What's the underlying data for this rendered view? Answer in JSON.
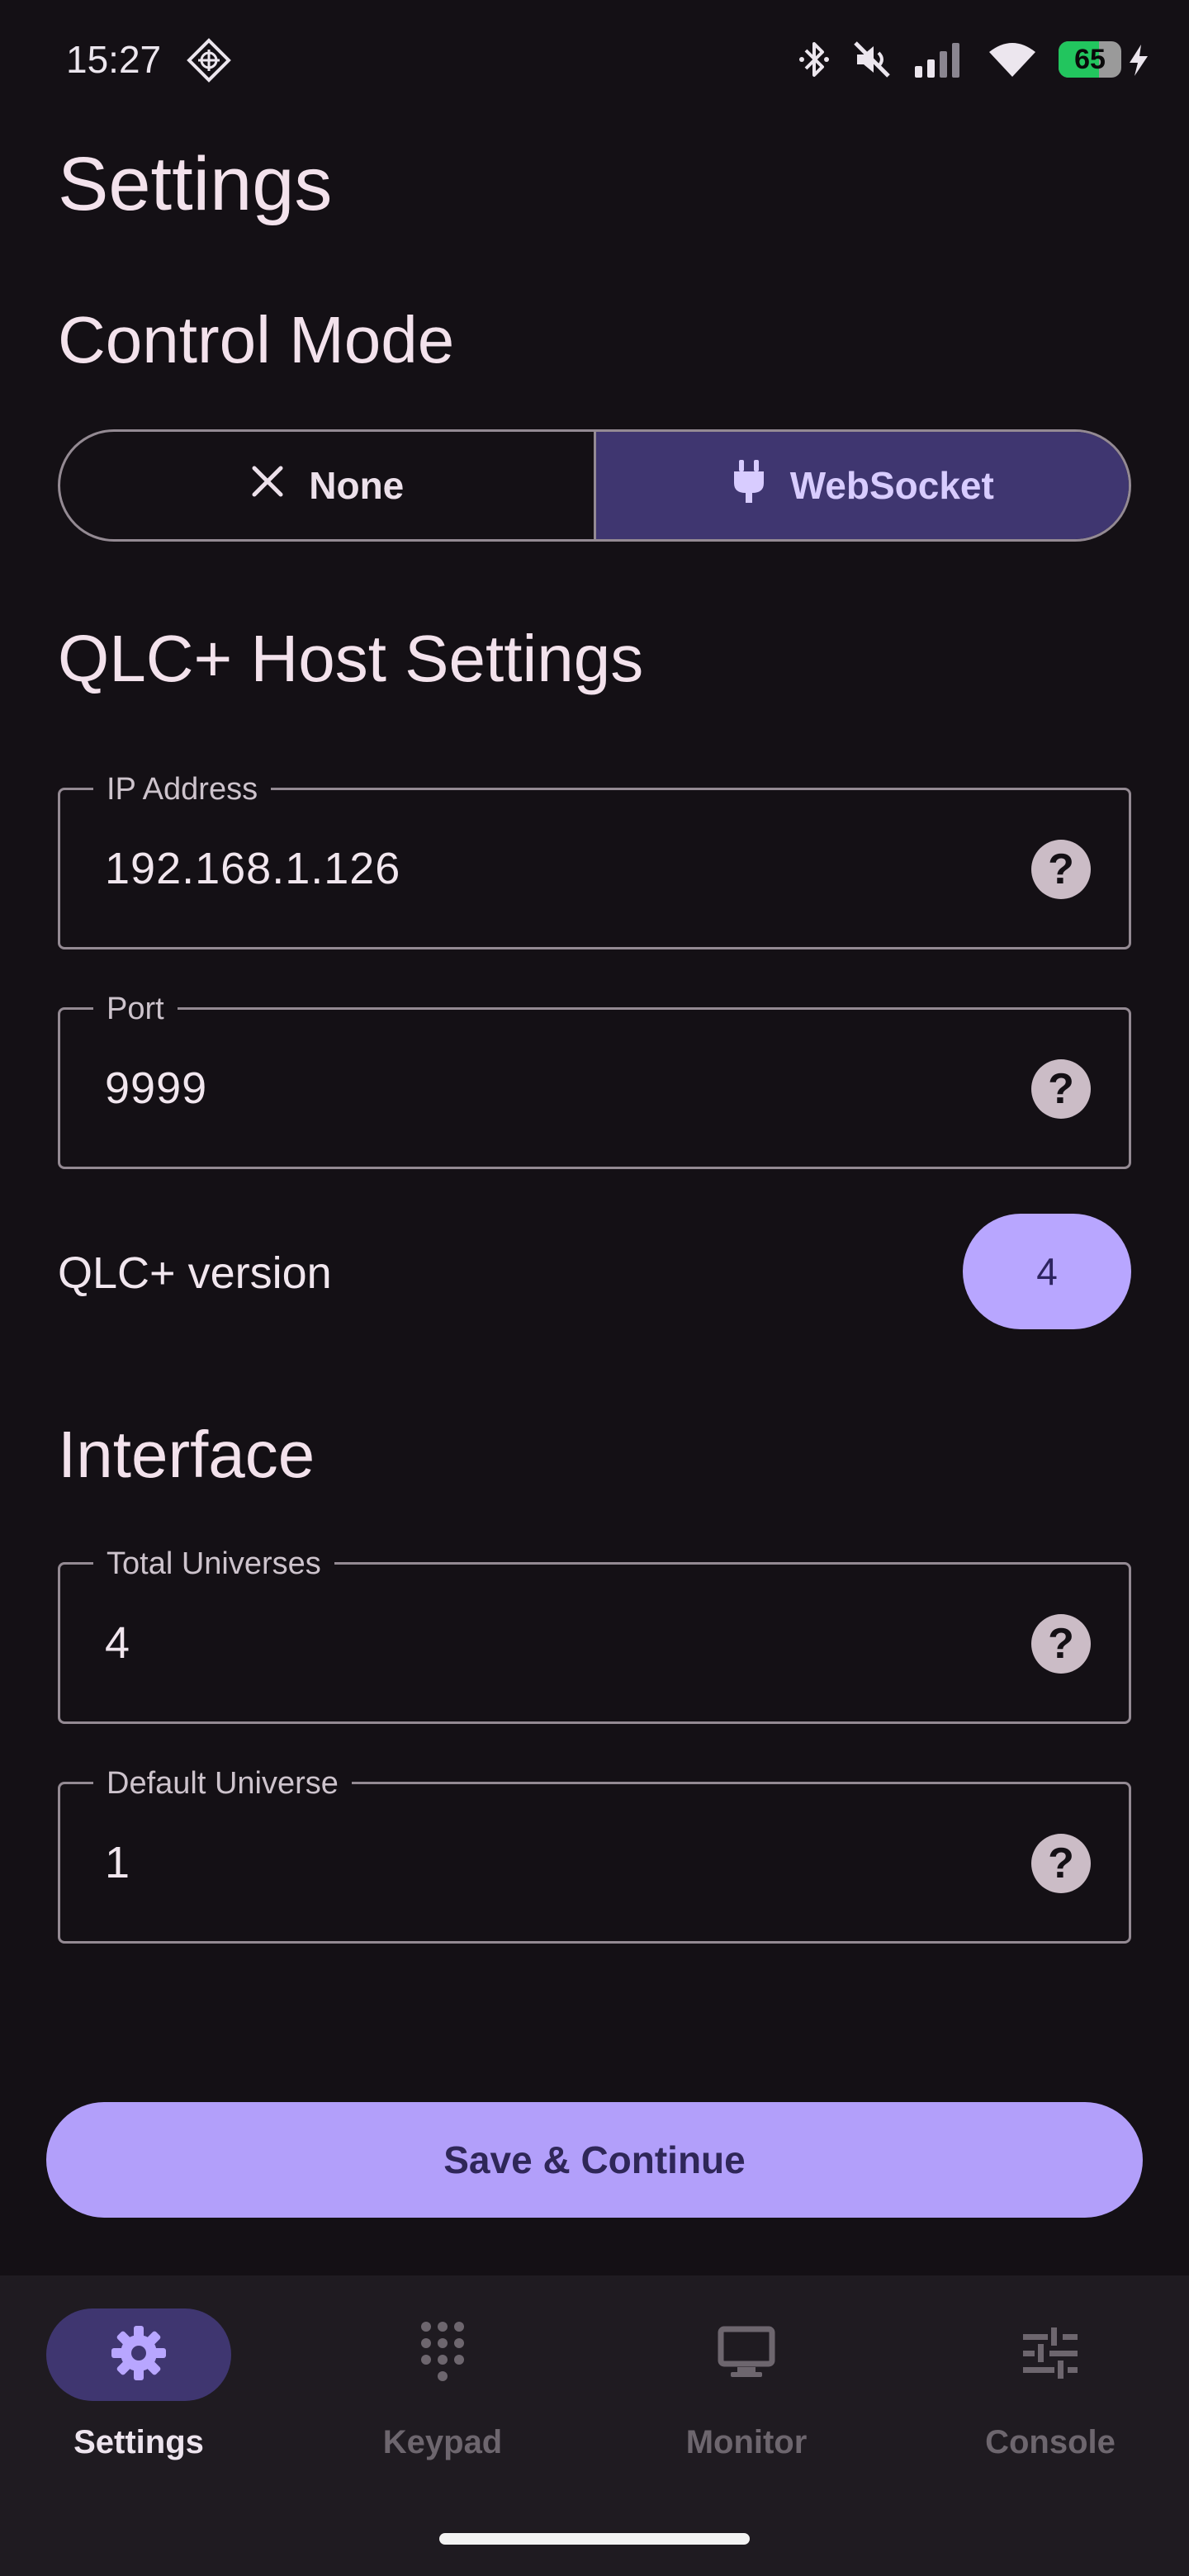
{
  "status_bar": {
    "time": "15:27",
    "battery_level": 65,
    "battery_text": "65",
    "icons": [
      "location-diamond-icon",
      "bluetooth-icon",
      "mute-icon",
      "signal-icon",
      "wifi-icon",
      "battery-icon",
      "charging-bolt-icon"
    ]
  },
  "page": {
    "title": "Settings"
  },
  "control_mode": {
    "title": "Control Mode",
    "options": [
      {
        "label": "None",
        "icon": "close-icon",
        "selected": false
      },
      {
        "label": "WebSocket",
        "icon": "plug-icon",
        "selected": true
      }
    ]
  },
  "host_settings": {
    "title": "QLC+ Host Settings",
    "ip": {
      "label": "IP Address",
      "value": "192.168.1.126"
    },
    "port": {
      "label": "Port",
      "value": "9999"
    },
    "version": {
      "label": "QLC+ version",
      "value": "4"
    }
  },
  "interface": {
    "title": "Interface",
    "total_universes": {
      "label": "Total Universes",
      "value": "4"
    },
    "default_universe": {
      "label": "Default Universe",
      "value": "1"
    }
  },
  "help_glyph": "?",
  "actions": {
    "save_label": "Save & Continue"
  },
  "nav": {
    "items": [
      {
        "label": "Settings",
        "icon": "gear-icon",
        "active": true
      },
      {
        "label": "Keypad",
        "icon": "dialpad-icon",
        "active": false
      },
      {
        "label": "Monitor",
        "icon": "monitor-icon",
        "active": false
      },
      {
        "label": "Console",
        "icon": "sliders-icon",
        "active": false
      }
    ]
  },
  "colors": {
    "background": "#141015",
    "accent": "#b29ffa",
    "accent_container": "#3f3670",
    "outline": "#948a93",
    "battery_green": "#22c55e"
  }
}
